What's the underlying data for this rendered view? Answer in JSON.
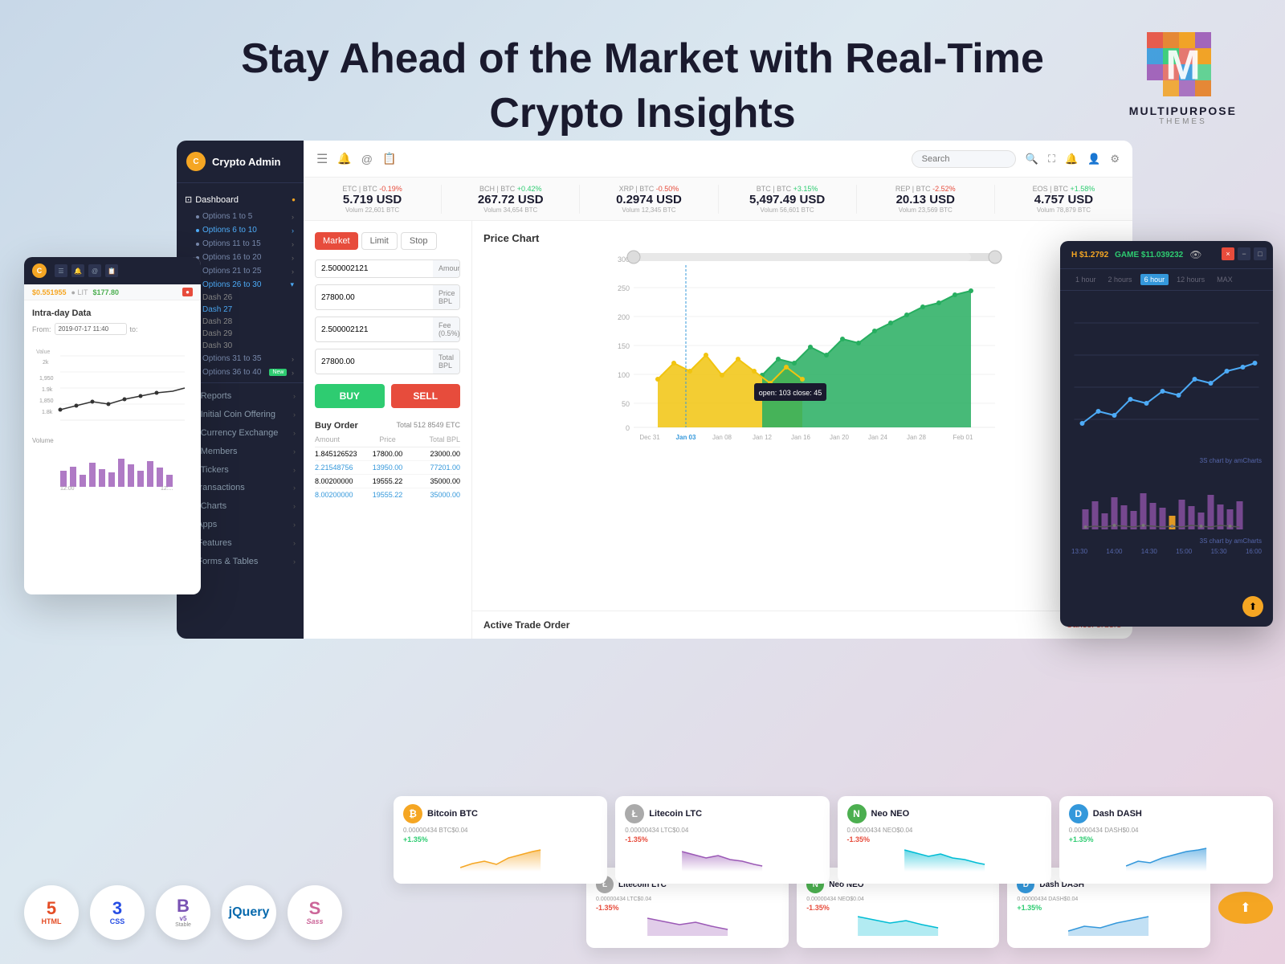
{
  "header": {
    "title_line1": "Stay Ahead of the Market with Real-Time",
    "title_line2": "Crypto Insights"
  },
  "brand": {
    "name": "MULTIPURPOSE",
    "sub": "THEMES"
  },
  "sidebar": {
    "logo": "C",
    "app_name": "Crypto Admin",
    "menu": [
      {
        "icon": "⊡",
        "label": "Dashboard",
        "active": true
      },
      {
        "label": "Options 1 to 5"
      },
      {
        "label": "Options 6 to 10",
        "active_text": true
      },
      {
        "label": "Options 11 to 15"
      },
      {
        "label": "Options 16 to 20"
      },
      {
        "label": "Options 21 to 25"
      },
      {
        "label": "Options 26 to 30",
        "expanded": true
      },
      {
        "label": "Dash 26",
        "sub": true
      },
      {
        "label": "Dash 27",
        "sub": true,
        "highlighted": true
      },
      {
        "label": "Dash 28",
        "sub": true
      },
      {
        "label": "Dash 29",
        "sub": true
      },
      {
        "label": "Dash 30",
        "sub": true
      },
      {
        "label": "Options 31 to 35"
      },
      {
        "label": "Options 36 to 40",
        "badge": "New"
      }
    ],
    "sections": [
      {
        "icon": "📊",
        "label": "Reports"
      },
      {
        "icon": "⭕",
        "label": "Initial Coin Offering"
      },
      {
        "icon": "💱",
        "label": "Currency Exchange"
      },
      {
        "icon": "👥",
        "label": "Members"
      },
      {
        "icon": "📈",
        "label": "Tickers"
      },
      {
        "icon": "$",
        "label": "Transactions"
      },
      {
        "icon": "📉",
        "label": "Charts"
      },
      {
        "icon": "⊞",
        "label": "Apps"
      },
      {
        "icon": "✦",
        "label": "Features"
      },
      {
        "icon": "⊟",
        "label": "Forms & Tables"
      }
    ]
  },
  "topnav": {
    "search_placeholder": "Search"
  },
  "ticker": [
    {
      "pair": "ETC | BTC",
      "change": "-0.19%",
      "change_pos": false,
      "price": "5.719 USD",
      "volume": "22,601 BTC"
    },
    {
      "pair": "BCH | BTC",
      "change": "+0.42%",
      "change_pos": true,
      "price": "267.72 USD",
      "volume": "34,654 BTC"
    },
    {
      "pair": "XRP | BTC",
      "change": "-0.50%",
      "change_pos": false,
      "price": "0.2974 USD",
      "volume": "12,345 BTC"
    },
    {
      "pair": "BTC | BTC",
      "change": "+3.15%",
      "change_pos": true,
      "price": "5,497.49 USD",
      "volume": "56,601 BTC"
    },
    {
      "pair": "REP | BTC",
      "change": "-2.52%",
      "change_pos": false,
      "price": "20.13 USD",
      "volume": "23,569 BTC"
    },
    {
      "pair": "EOS | BTC",
      "change": "+1.58%",
      "change_pos": true,
      "price": "4.757 USD",
      "volume": "78,879 BTC"
    }
  ],
  "order_form": {
    "tabs": [
      "Market",
      "Limit",
      "Stop"
    ],
    "active_tab": "Market",
    "fields": [
      {
        "value": "2.500002121",
        "label": "Amount BTC"
      },
      {
        "value": "27800.00",
        "label": "Price BPL"
      },
      {
        "value": "2.500002121",
        "label": "Fee (0.5%)"
      },
      {
        "value": "27800.00",
        "label": "Total BPL"
      }
    ],
    "buy_label": "BUY",
    "sell_label": "SELL"
  },
  "buy_orders": {
    "title": "Buy Order",
    "total": "Total 512 8549 ETC",
    "headers": [
      "Amount",
      "Price",
      "Total BPL"
    ],
    "rows": [
      {
        "amount": "1.845126523",
        "price": "17800.00",
        "total": "23000.00"
      },
      {
        "amount": "2.21548756",
        "price": "13950.00",
        "total": "77201.00",
        "highlight": true
      },
      {
        "amount": "8.00200000",
        "price": "19555.22",
        "total": "35000.00"
      },
      {
        "amount": "8.00200000",
        "price": "19555.22",
        "total": "35000.00",
        "highlight": true
      }
    ]
  },
  "chart": {
    "title": "Price Chart",
    "tooltip": "open: 103 close: 45",
    "x_labels": [
      "Dec 31",
      "Jan 03",
      "Jan 08",
      "Jan 12",
      "Jan 16",
      "Jan 20",
      "Jan 24",
      "Jan 28",
      "Feb 01"
    ],
    "y_labels": [
      "0",
      "50",
      "100",
      "150",
      "200",
      "250",
      "300"
    ]
  },
  "active_trade": {
    "title": "Active Trade Order",
    "cancel_label": "Cancel orders"
  },
  "intraday": {
    "title": "Intra-day Data",
    "from_label": "From:",
    "from_value": "2019-07-17 11:40",
    "to_label": "to:",
    "value_label": "Value",
    "volume_label": "Volume",
    "y_values": [
      "2k",
      "1,950",
      "1.9k",
      "1,850",
      "1.8k"
    ],
    "time_labels": [
      "12:00",
      "12:..."
    ]
  },
  "right_chart": {
    "ticker1": "H $1.2792",
    "ticker2": "GAME $11.039232",
    "timeframes": [
      "1 hour",
      "2 hours",
      "6 hour",
      "12 hours",
      "MAX"
    ],
    "active_tf": "6 hour",
    "label": "3S chart by amCharts",
    "bottom_label": "3S chart by amCharts"
  },
  "currency_cards": [
    {
      "icon": "₿",
      "icon_class": "btc",
      "name": "Bitcoin BTC",
      "amount": "0.00000434 BTC$0.04",
      "change": "+1.35%",
      "pos": true,
      "color1": "#f5a623",
      "color2": "#f7c06b"
    },
    {
      "icon": "Ł",
      "icon_class": "ltc",
      "name": "Litecoin LTC",
      "amount": "0.00000434 LTC$0.04",
      "change": "-1.35%",
      "pos": false,
      "color1": "#aaa",
      "color2": "#ccc"
    },
    {
      "icon": "N",
      "icon_class": "neo",
      "name": "Neo NEO",
      "amount": "0.00000434 NEO$0.04",
      "change": "-1.35%",
      "pos": false,
      "color1": "#4caf50",
      "color2": "#81c784"
    },
    {
      "icon": "D",
      "icon_class": "dash",
      "name": "Dash DASH",
      "amount": "0.00000434 DASH$0.04",
      "change": "+1.35%",
      "pos": true,
      "color1": "#3498db",
      "color2": "#74b9ff"
    },
    {
      "icon": "Ł",
      "icon_class": "ltc",
      "name": "Litecoin LTC",
      "amount": "0.00000434 LTC$0.04",
      "change": "-1.35%",
      "pos": false,
      "color1": "#aaa",
      "color2": "#ccc"
    },
    {
      "icon": "N",
      "icon_class": "neo",
      "name": "Neo NEO",
      "amount": "0.00000434 NEO$0.04",
      "change": "-1.35%",
      "pos": false,
      "color1": "#4caf50",
      "color2": "#81c784"
    },
    {
      "icon": "D",
      "icon_class": "dash",
      "name": "Dash DASH",
      "amount": "0.00000434 DASH$0.04",
      "change": "+1.35%",
      "pos": true,
      "color1": "#3498db",
      "color2": "#74b9ff"
    }
  ],
  "tech_badges": [
    {
      "icon": "5",
      "label": "HTML",
      "color": "#e44d26",
      "sub": ""
    },
    {
      "icon": "3",
      "label": "CSS",
      "color": "#264de4",
      "sub": ""
    },
    {
      "icon": "B",
      "label": "Bootstrap",
      "color": "#7952b3",
      "sub": "v5 Stable"
    },
    {
      "icon": "jQ",
      "label": "jQuery",
      "color": "#0769ad",
      "sub": ""
    },
    {
      "icon": "S",
      "label": "Sass",
      "color": "#cc6699",
      "sub": ""
    }
  ],
  "colors": {
    "buy": "#2ecc71",
    "sell": "#e74c3c",
    "highlight": "#3498db",
    "chart_green": "#27ae60",
    "chart_yellow": "#f1c40f",
    "sidebar_bg": "#1e2235"
  }
}
